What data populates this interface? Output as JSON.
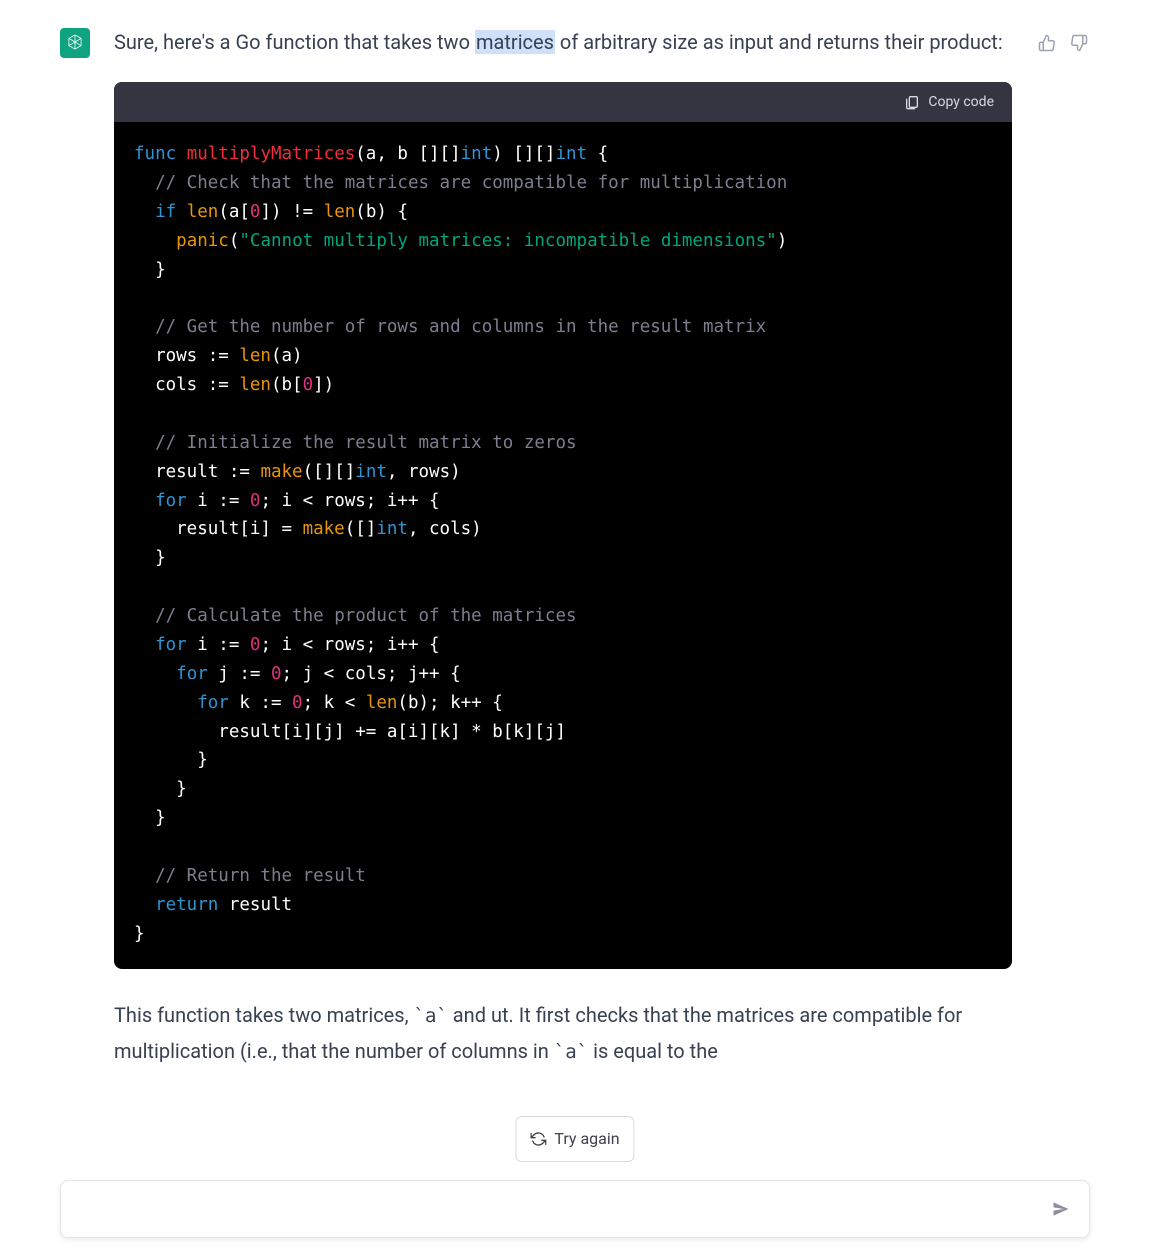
{
  "message": {
    "text_before_highlight": "Sure, here's a Go function that takes two ",
    "highlighted_word": "matrices",
    "text_after_highlight": " of arbitrary size as input and returns their product:"
  },
  "code": {
    "copy_label": "Copy code",
    "tokens": [
      [
        {
          "t": "func ",
          "c": "kw"
        },
        {
          "t": "multiplyMatrices",
          "c": "fn"
        },
        {
          "t": "(a, b [][]",
          "c": ""
        },
        {
          "t": "int",
          "c": "type"
        },
        {
          "t": ") [][]",
          "c": ""
        },
        {
          "t": "int",
          "c": "type"
        },
        {
          "t": " {",
          "c": ""
        }
      ],
      [
        {
          "t": "  ",
          "c": ""
        },
        {
          "t": "// Check that the matrices are compatible for multiplication",
          "c": "cm"
        }
      ],
      [
        {
          "t": "  ",
          "c": ""
        },
        {
          "t": "if",
          "c": "kw"
        },
        {
          "t": " ",
          "c": ""
        },
        {
          "t": "len",
          "c": "builtin"
        },
        {
          "t": "(a[",
          "c": ""
        },
        {
          "t": "0",
          "c": "num"
        },
        {
          "t": "]) != ",
          "c": ""
        },
        {
          "t": "len",
          "c": "builtin"
        },
        {
          "t": "(b) {",
          "c": ""
        }
      ],
      [
        {
          "t": "    ",
          "c": ""
        },
        {
          "t": "panic",
          "c": "builtin"
        },
        {
          "t": "(",
          "c": ""
        },
        {
          "t": "\"Cannot multiply matrices: incompatible dimensions\"",
          "c": "str"
        },
        {
          "t": ")",
          "c": ""
        }
      ],
      [
        {
          "t": "  }",
          "c": ""
        }
      ],
      [
        {
          "t": "",
          "c": ""
        }
      ],
      [
        {
          "t": "  ",
          "c": ""
        },
        {
          "t": "// Get the number of rows and columns in the result matrix",
          "c": "cm"
        }
      ],
      [
        {
          "t": "  rows := ",
          "c": ""
        },
        {
          "t": "len",
          "c": "builtin"
        },
        {
          "t": "(a)",
          "c": ""
        }
      ],
      [
        {
          "t": "  cols := ",
          "c": ""
        },
        {
          "t": "len",
          "c": "builtin"
        },
        {
          "t": "(b[",
          "c": ""
        },
        {
          "t": "0",
          "c": "num"
        },
        {
          "t": "])",
          "c": ""
        }
      ],
      [
        {
          "t": "",
          "c": ""
        }
      ],
      [
        {
          "t": "  ",
          "c": ""
        },
        {
          "t": "// Initialize the result matrix to zeros",
          "c": "cm"
        }
      ],
      [
        {
          "t": "  result := ",
          "c": ""
        },
        {
          "t": "make",
          "c": "builtin"
        },
        {
          "t": "([][]",
          "c": ""
        },
        {
          "t": "int",
          "c": "type"
        },
        {
          "t": ", rows)",
          "c": ""
        }
      ],
      [
        {
          "t": "  ",
          "c": ""
        },
        {
          "t": "for",
          "c": "kw"
        },
        {
          "t": " i := ",
          "c": ""
        },
        {
          "t": "0",
          "c": "num"
        },
        {
          "t": "; i < rows; i++ {",
          "c": ""
        }
      ],
      [
        {
          "t": "    result[i] = ",
          "c": ""
        },
        {
          "t": "make",
          "c": "builtin"
        },
        {
          "t": "([]",
          "c": ""
        },
        {
          "t": "int",
          "c": "type"
        },
        {
          "t": ", cols)",
          "c": ""
        }
      ],
      [
        {
          "t": "  }",
          "c": ""
        }
      ],
      [
        {
          "t": "",
          "c": ""
        }
      ],
      [
        {
          "t": "  ",
          "c": ""
        },
        {
          "t": "// Calculate the product of the matrices",
          "c": "cm"
        }
      ],
      [
        {
          "t": "  ",
          "c": ""
        },
        {
          "t": "for",
          "c": "kw"
        },
        {
          "t": " i := ",
          "c": ""
        },
        {
          "t": "0",
          "c": "num"
        },
        {
          "t": "; i < rows; i++ {",
          "c": ""
        }
      ],
      [
        {
          "t": "    ",
          "c": ""
        },
        {
          "t": "for",
          "c": "kw"
        },
        {
          "t": " j := ",
          "c": ""
        },
        {
          "t": "0",
          "c": "num"
        },
        {
          "t": "; j < cols; j++ {",
          "c": ""
        }
      ],
      [
        {
          "t": "      ",
          "c": ""
        },
        {
          "t": "for",
          "c": "kw"
        },
        {
          "t": " k := ",
          "c": ""
        },
        {
          "t": "0",
          "c": "num"
        },
        {
          "t": "; k < ",
          "c": ""
        },
        {
          "t": "len",
          "c": "builtin"
        },
        {
          "t": "(b); k++ {",
          "c": ""
        }
      ],
      [
        {
          "t": "        result[i][j] += a[i][k] * b[k][j]",
          "c": ""
        }
      ],
      [
        {
          "t": "      }",
          "c": ""
        }
      ],
      [
        {
          "t": "    }",
          "c": ""
        }
      ],
      [
        {
          "t": "  }",
          "c": ""
        }
      ],
      [
        {
          "t": "",
          "c": ""
        }
      ],
      [
        {
          "t": "  ",
          "c": ""
        },
        {
          "t": "// Return the result",
          "c": "cm"
        }
      ],
      [
        {
          "t": "  ",
          "c": ""
        },
        {
          "t": "return",
          "c": "kw"
        },
        {
          "t": " result",
          "c": ""
        }
      ],
      [
        {
          "t": "}",
          "c": ""
        }
      ]
    ]
  },
  "after_code": {
    "part1": "This function takes two matrices, ",
    "code_a": "`a`",
    "part2": " and ",
    "cutoff1": "ut. It first checks that the matrices are compatible for multiplication (i.e., that the number of columns in ",
    "code_a2": "`a`",
    "part3": " is equal to the"
  },
  "try_again_label": "Try again",
  "input_placeholder": "",
  "icons": {
    "thumbs_up": "thumbs-up-icon",
    "thumbs_down": "thumbs-down-icon",
    "clipboard": "clipboard-icon",
    "refresh": "refresh-icon",
    "send": "send-icon",
    "logo": "assistant-logo-icon"
  }
}
